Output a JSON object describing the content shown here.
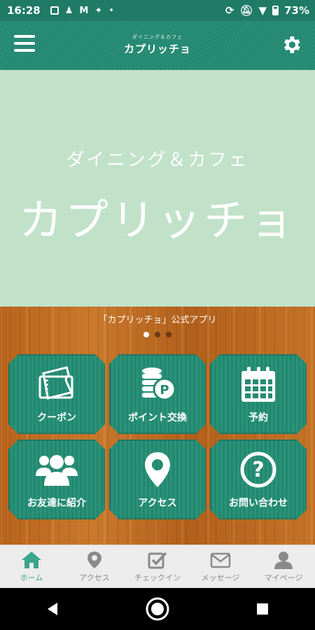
{
  "status_bar": {
    "time": "16:28",
    "battery": "73%"
  },
  "header": {
    "subtitle": "ダイニング＆カフェ",
    "title": "カプリッチョ"
  },
  "hero": {
    "subtitle": "ダイニング＆カフェ",
    "title": "カプリッチョ"
  },
  "carousel": {
    "caption": "「カプリッチョ」公式アプリ",
    "pages": 3,
    "active_page": 1
  },
  "tiles": [
    {
      "label": "クーポン",
      "icon": "ticket-icon"
    },
    {
      "label": "ポイント交換",
      "icon": "coins-icon"
    },
    {
      "label": "予約",
      "icon": "calendar-icon"
    },
    {
      "label": "お友達に紹介",
      "icon": "users-icon"
    },
    {
      "label": "アクセス",
      "icon": "map-pin-icon"
    },
    {
      "label": "お問い合わせ",
      "icon": "question-icon"
    }
  ],
  "bottom_nav": [
    {
      "label": "ホーム",
      "icon": "home-icon",
      "active": true
    },
    {
      "label": "アクセス",
      "icon": "map-pin-icon"
    },
    {
      "label": "チェックイン",
      "icon": "checkbox-icon"
    },
    {
      "label": "メッセージ",
      "icon": "mail-icon"
    },
    {
      "label": "マイページ",
      "icon": "user-icon"
    }
  ],
  "colors": {
    "primary": "#268a72",
    "hero_bg": "#c1e2c9",
    "wood": "#c0701f",
    "nav_active": "#3ba58e",
    "nav_inactive": "#8a8a8a"
  }
}
